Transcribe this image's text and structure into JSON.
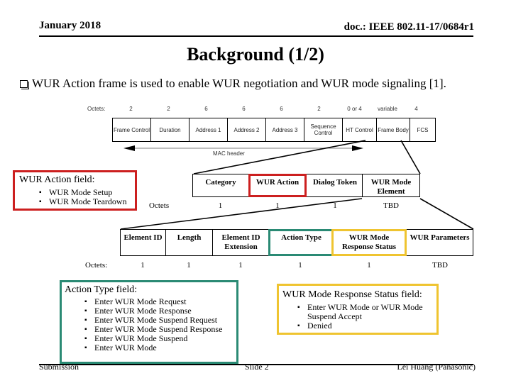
{
  "header": {
    "date": "January 2018",
    "doc_id": "doc.: IEEE 802.11-17/0684r1"
  },
  "title": "Background (1/2)",
  "intro_bullet": {
    "icon": "checkbox-square-icon",
    "text": "WUR Action frame is used to enable WUR negotiation and WUR mode signaling [1]."
  },
  "mac_frame": {
    "octets_label": "Octets:",
    "fields": [
      {
        "label": "Frame Control",
        "octets": "2"
      },
      {
        "label": "Duration",
        "octets": "2"
      },
      {
        "label": "Address 1",
        "octets": "6"
      },
      {
        "label": "Address 2",
        "octets": "6"
      },
      {
        "label": "Address 3",
        "octets": "6"
      },
      {
        "label": "Sequence Control",
        "octets": "2"
      },
      {
        "label": "HT Control",
        "octets": "0 or 4"
      },
      {
        "label": "Frame Body",
        "octets": "variable"
      },
      {
        "label": "FCS",
        "octets": "4"
      }
    ],
    "header_span_label": "MAC header"
  },
  "action_frame": {
    "octets_label": "Octets",
    "fields": [
      {
        "label": "Category",
        "octets": "1"
      },
      {
        "label": "WUR Action",
        "octets": "1"
      },
      {
        "label": "Dialog Token",
        "octets": "1"
      },
      {
        "label": "WUR Mode Element",
        "octets": "TBD"
      }
    ]
  },
  "wur_mode_element": {
    "octets_label": "Octets:",
    "fields": [
      {
        "label": "Element ID",
        "octets": "1"
      },
      {
        "label": "Length",
        "octets": "1"
      },
      {
        "label": "Element ID Extension",
        "octets": "1"
      },
      {
        "label": "Action Type",
        "octets": "1"
      },
      {
        "label": "WUR Mode Response Status",
        "octets": "1"
      },
      {
        "label": "WUR Parameters",
        "octets": "TBD"
      }
    ]
  },
  "wur_action_box": {
    "title": "WUR Action field:",
    "items": [
      "WUR Mode Setup",
      "WUR Mode Teardown"
    ],
    "color": "#cc1f1f"
  },
  "action_type_box": {
    "title": "Action Type field:",
    "items": [
      "Enter WUR Mode Request",
      "Enter WUR Mode Response",
      "Enter WUR Mode Suspend Request",
      "Enter WUR Mode Suspend Response",
      "Enter WUR Mode Suspend",
      "Enter WUR Mode"
    ],
    "color": "#2a8a74"
  },
  "response_status_box": {
    "title": "WUR Mode Response Status field:",
    "items": [
      "Enter WUR Mode or WUR Mode Suspend Accept",
      "Denied"
    ],
    "color": "#efc430"
  },
  "footer": {
    "left": "Submission",
    "center": "Slide 2",
    "right": "Lei Huang (Panasonic)"
  }
}
